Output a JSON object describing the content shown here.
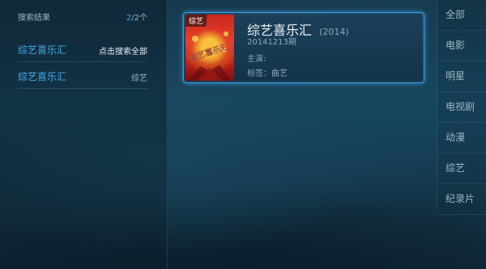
{
  "left_panel": {
    "title": "搜索结果",
    "count_current": "2",
    "count_suffix": "/2个",
    "results": [
      {
        "name": "综艺喜乐汇",
        "tag": "点击搜索全部"
      },
      {
        "name": "综艺喜乐汇",
        "tag": "综艺"
      }
    ]
  },
  "card": {
    "genre_badge": "综艺",
    "title": "综艺喜乐汇",
    "year": "(2014)",
    "episode": "20141213期",
    "starring": "主演:",
    "tags": "标签：曲艺",
    "poster_art_text": "综艺喜乐汇"
  },
  "categories": [
    "全部",
    "电影",
    "明星",
    "电视剧",
    "动漫",
    "综艺",
    "纪录片"
  ],
  "colors": {
    "accent": "#3aa7e6",
    "card_border": "#3e9ee0"
  }
}
